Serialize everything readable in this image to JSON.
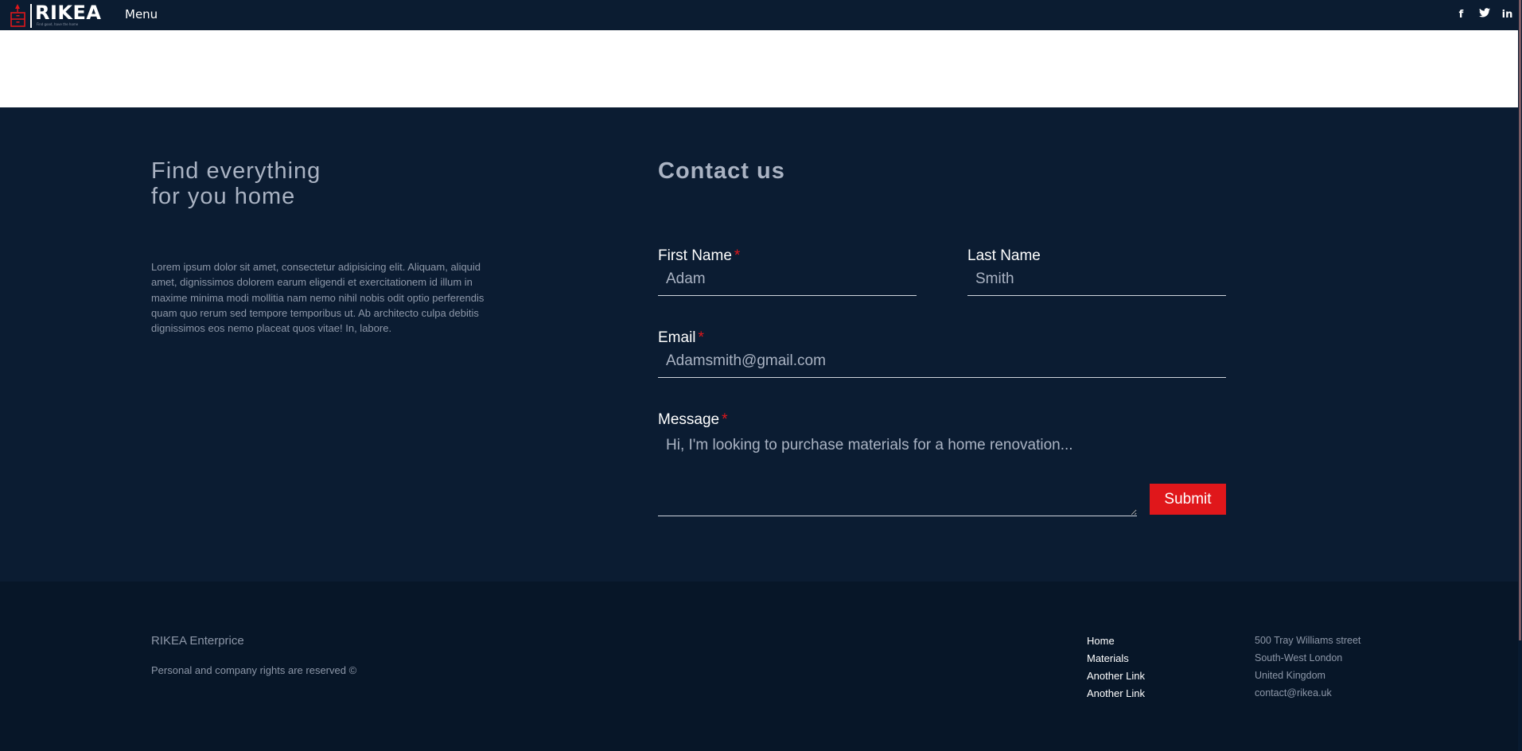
{
  "header": {
    "brand_name": "RIKEA",
    "brand_tagline": "Find good, have the home",
    "menu_label": "Menu",
    "socials": [
      {
        "icon": "facebook-icon",
        "glyph": "f"
      },
      {
        "icon": "twitter-icon",
        "glyph": "𝕥"
      },
      {
        "icon": "linkedin-icon",
        "glyph": "in"
      }
    ]
  },
  "intro": {
    "title_line1": "Find everything",
    "title_line2": "for you home",
    "description": "Lorem ipsum dolor sit amet, consectetur adipisicing elit. Aliquam, aliquid amet, dignissimos dolorem earum eligendi et exercitationem id illum in maxime minima modi mollitia nam nemo nihil nobis odit optio perferendis quam quo rerum sed tempore temporibus ut. Ab architecto culpa debitis dignissimos eos nemo placeat quos vitae! In, labore."
  },
  "contact": {
    "title": "Contact us",
    "first_name": {
      "label": "First Name",
      "required_mark": "*",
      "placeholder": "Adam"
    },
    "last_name": {
      "label": "Last Name",
      "placeholder": "Smith"
    },
    "email": {
      "label": "Email",
      "required_mark": "*",
      "placeholder": "Adamsmith@gmail.com"
    },
    "message": {
      "label": "Message",
      "required_mark": "*",
      "placeholder": "Hi, I'm looking to purchase materials for a home renovation..."
    },
    "submit_label": "Submit"
  },
  "footer": {
    "company": "RIKEA Enterprice",
    "rights": "Personal and company rights are reserved ©",
    "links": [
      "Home",
      "Materials",
      "Another Link",
      "Another Link"
    ],
    "address": [
      "500 Tray Williams street",
      "South-West London",
      "United Kingdom",
      "contact@rikea.uk"
    ]
  },
  "colors": {
    "nav_bg": "#0b1c31",
    "section_bg": "#0b1c32",
    "footer_bg": "#071628",
    "accent": "#e0171b"
  }
}
